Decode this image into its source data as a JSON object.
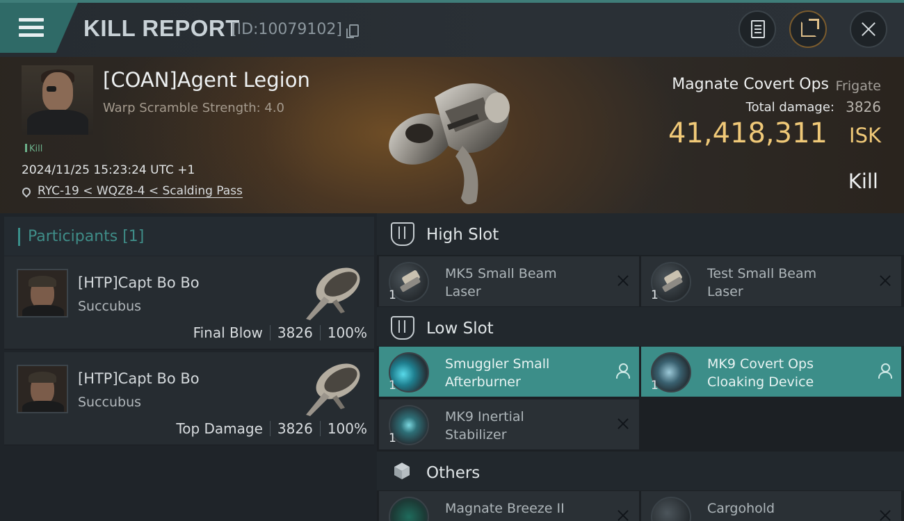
{
  "header": {
    "title": "KILL REPORT",
    "report_id": "[ID:10079102]"
  },
  "victim": {
    "name": "[COAN]Agent Legion",
    "warp_scramble": "Warp Scramble Strength: 4.0",
    "tag": "Kill",
    "datetime": "2024/11/25 15:23:24 UTC +1",
    "location": "RYC-19 < WQZ8-4 < Scalding Pass"
  },
  "ship": {
    "name": "Magnate Covert Ops",
    "class": "Frigate",
    "damage_label": "Total damage:",
    "damage_value": "3826",
    "isk_value": "41,418,311",
    "isk_unit": "ISK",
    "result": "Kill"
  },
  "participants": {
    "header": "Participants [1]",
    "items": [
      {
        "name": "[HTP]Capt Bo Bo",
        "ship": "Succubus",
        "role": "Final Blow",
        "damage": "3826",
        "percent": "100%"
      },
      {
        "name": "[HTP]Capt Bo Bo",
        "ship": "Succubus",
        "role": "Top Damage",
        "damage": "3826",
        "percent": "100%"
      }
    ]
  },
  "modules": {
    "high_label": "High Slot",
    "low_label": "Low Slot",
    "others_label": "Others",
    "high": [
      {
        "name1": "MK5 Small Beam",
        "name2": "Laser",
        "qty": "1"
      },
      {
        "name1": "Test Small Beam",
        "name2": "Laser",
        "qty": "1"
      }
    ],
    "low": [
      {
        "name1": "Smuggler Small",
        "name2": "Afterburner",
        "qty": "1"
      },
      {
        "name1": "MK9 Covert Ops",
        "name2": "Cloaking Device",
        "qty": "1"
      },
      {
        "name1": "MK9 Inertial",
        "name2": "Stabilizer",
        "qty": "1"
      }
    ],
    "others": [
      {
        "name1": "Magnate Breeze II"
      },
      {
        "name1": "Cargohold"
      }
    ]
  },
  "colors": {
    "accent": "#3c8e89",
    "isk": "#f0c978"
  }
}
